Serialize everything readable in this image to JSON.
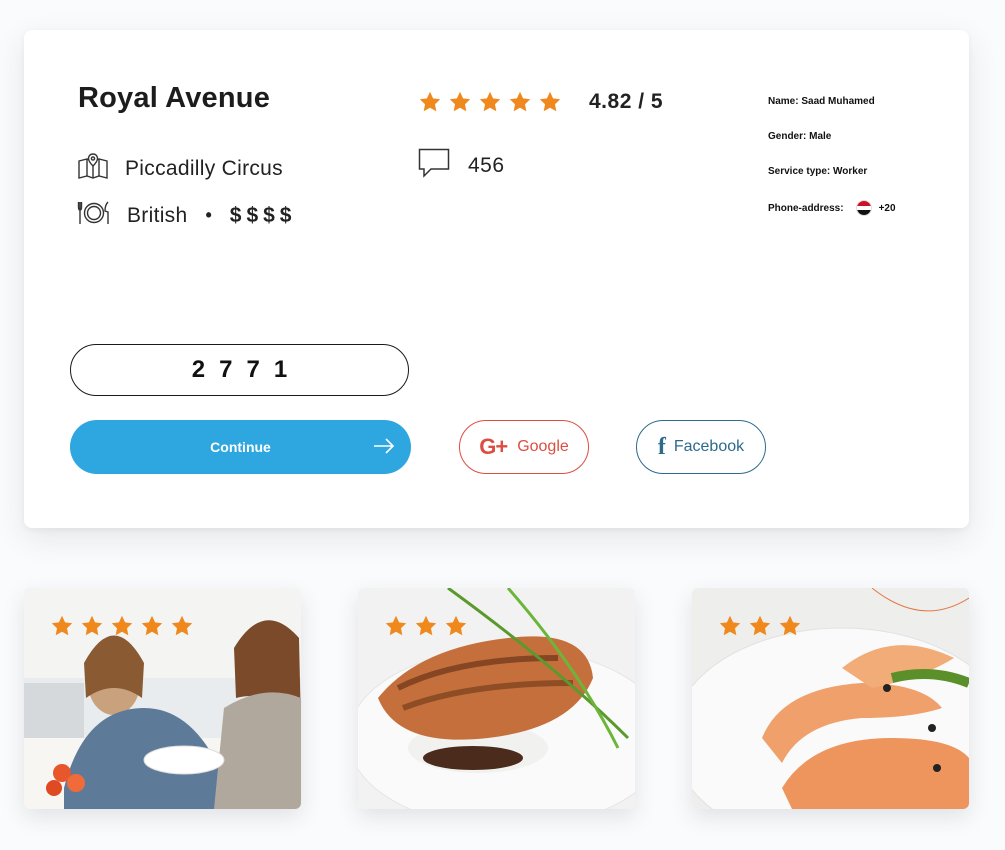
{
  "restaurant": {
    "name": "Royal Avenue",
    "location": "Piccadilly Circus",
    "cuisine": "British",
    "separator": "•",
    "price": "$$$$",
    "rating_text": "4.82 / 5",
    "rating_stars": 5,
    "comments": "456"
  },
  "contact": {
    "name": "Name: Saad Muhamed",
    "gender": "Gender: Male",
    "service": "Service type: Worker",
    "phone_label": "Phone-address:",
    "phone_code": "+20"
  },
  "form": {
    "code_value": "2771",
    "continue_label": "Continue",
    "google_label": "Google",
    "google_glyph": "G+",
    "facebook_label": "Facebook",
    "facebook_glyph": "f"
  },
  "icons": {
    "location": "map-icon",
    "cuisine": "plate-cutlery-icon",
    "comments": "speech-bubble-icon",
    "continue": "arrow-right-icon",
    "star": "star-icon"
  },
  "colors": {
    "accent": "#2ea6df",
    "star": "#f0891d",
    "google": "#dc4e41",
    "facebook": "#2d6a8c"
  },
  "gallery": [
    {
      "subject": "couple dining",
      "stars": 5
    },
    {
      "subject": "grilled salmon with rice",
      "stars": 3
    },
    {
      "subject": "shrimp platter",
      "stars": 3
    }
  ]
}
